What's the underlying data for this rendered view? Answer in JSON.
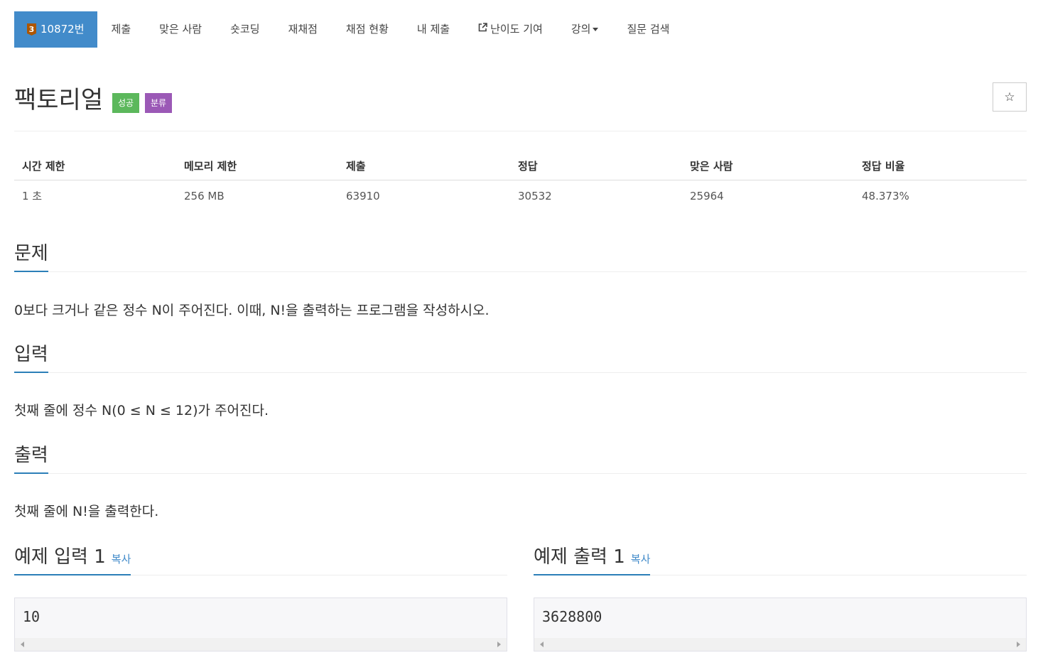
{
  "nav": {
    "problem_tier": "3",
    "items": [
      {
        "label": "10872번"
      },
      {
        "label": "제출"
      },
      {
        "label": "맞은 사람"
      },
      {
        "label": "숏코딩"
      },
      {
        "label": "재채점"
      },
      {
        "label": "채점 현황"
      },
      {
        "label": "내 제출"
      },
      {
        "label": "난이도 기여"
      },
      {
        "label": "강의"
      },
      {
        "label": "질문 검색"
      }
    ]
  },
  "problem": {
    "title": "팩토리얼",
    "label_success": "성공",
    "label_category": "분류",
    "star_icon": "☆"
  },
  "stats": {
    "headers": [
      "시간 제한",
      "메모리 제한",
      "제출",
      "정답",
      "맞은 사람",
      "정답 비율"
    ],
    "values": [
      "1 초",
      "256 MB",
      "63910",
      "30532",
      "25964",
      "48.373%"
    ]
  },
  "sections": {
    "description": {
      "heading": "문제",
      "text": "0보다 크거나 같은 정수 N이 주어진다. 이때, N!을 출력하는 프로그램을 작성하시오."
    },
    "input": {
      "heading": "입력",
      "text": "첫째 줄에 정수 N(0 ≤ N ≤ 12)가 주어진다."
    },
    "output": {
      "heading": "출력",
      "text": "첫째 줄에 N!을 출력한다."
    }
  },
  "samples": {
    "input_heading": "예제 입력 1",
    "output_heading": "예제 출력 1",
    "copy_label": "복사",
    "input_value": "10",
    "output_value": "3628800"
  },
  "colors": {
    "active_tab": "#428bca",
    "success": "#5cb85c",
    "category": "#9b59b6",
    "heading_underline": "#2c7fb8",
    "tier_bronze": "#ad5600"
  }
}
